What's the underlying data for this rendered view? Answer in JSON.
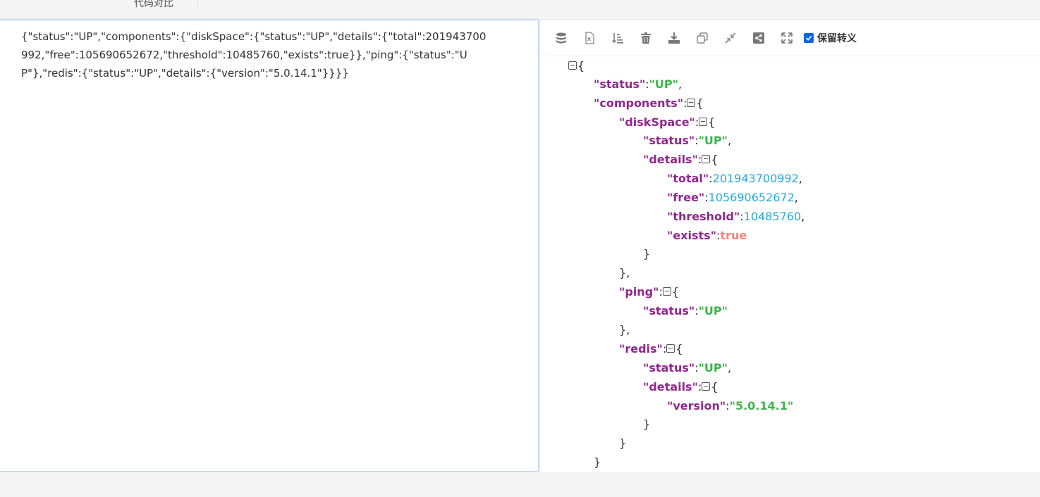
{
  "top": {
    "tab_label": "代码对比"
  },
  "input": {
    "raw_text": "{\"status\":\"UP\",\"components\":{\"diskSpace\":{\"status\":\"UP\",\"details\":{\"total\":201943700992,\"free\":105690652672,\"threshold\":10485760,\"exists\":true}},\"ping\":{\"status\":\"UP\"},\"redis\":{\"status\":\"UP\",\"details\":{\"version\":\"5.0.14.1\"}}}}"
  },
  "toolbar": {
    "icons": [
      "database-icon",
      "excel-icon",
      "sort-icon",
      "trash-icon",
      "download-icon",
      "copy-icon",
      "compress-icon",
      "share-icon",
      "expand-icon"
    ],
    "keep_escape_label": "保留转义",
    "keep_escape_checked": true
  },
  "tree": {
    "open_brace": "{",
    "close_brace": "}",
    "close_brace_comma": "},",
    "colon": ":",
    "comma": ",",
    "k_status": "\"status\"",
    "k_components": "\"components\"",
    "k_diskSpace": "\"diskSpace\"",
    "k_details": "\"details\"",
    "k_total": "\"total\"",
    "k_free": "\"free\"",
    "k_threshold": "\"threshold\"",
    "k_exists": "\"exists\"",
    "k_ping": "\"ping\"",
    "k_redis": "\"redis\"",
    "k_version": "\"version\"",
    "v_up": "\"UP\"",
    "v_total": "201943700992",
    "v_free": "105690652672",
    "v_threshold": "10485760",
    "v_exists": "true",
    "v_version": "\"5.0.14.1\""
  },
  "colors": {
    "key": "#92278f",
    "string": "#3ab54a",
    "number": "#25aae2",
    "boolean": "#f98280",
    "checkbox": "#0a66e4"
  }
}
